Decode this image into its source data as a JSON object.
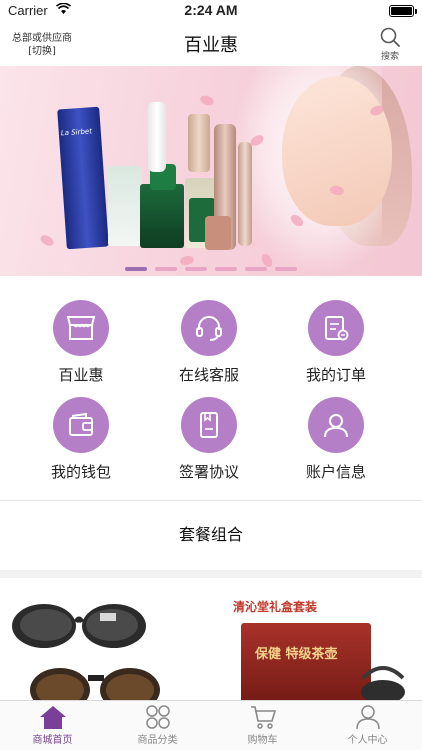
{
  "status_bar": {
    "carrier": "Carrier",
    "time": "2:24 AM"
  },
  "nav": {
    "switch_line1": "总部或供应商",
    "switch_line2": "[切换]",
    "title": "百业惠",
    "search_label": "搜索"
  },
  "banner": {
    "product_brand": "La Sirbet",
    "slide_count": 6,
    "active_slide": 0
  },
  "menu": {
    "items": [
      {
        "label": "百业惠",
        "icon": "store-icon"
      },
      {
        "label": "在线客服",
        "icon": "headset-icon"
      },
      {
        "label": "我的订单",
        "icon": "order-icon"
      },
      {
        "label": "我的钱包",
        "icon": "wallet-icon"
      },
      {
        "label": "签署协议",
        "icon": "agreement-icon"
      },
      {
        "label": "账户信息",
        "icon": "user-icon"
      }
    ]
  },
  "section": {
    "title": "套餐组合"
  },
  "products": {
    "right_caption": "清沁堂礼盒套装",
    "right_box_text": "保健 特级茶壶"
  },
  "tabbar": {
    "items": [
      {
        "label": "商城首页",
        "icon": "home-icon",
        "active": true
      },
      {
        "label": "商品分类",
        "icon": "grid-icon",
        "active": false
      },
      {
        "label": "购物车",
        "icon": "cart-icon",
        "active": false
      },
      {
        "label": "个人中心",
        "icon": "person-icon",
        "active": false
      }
    ]
  },
  "colors": {
    "accent": "#b57fc8",
    "tab_active": "#7b3f97",
    "dot_active": "#9c6fb0",
    "dot_inactive": "#e7a6c4"
  }
}
